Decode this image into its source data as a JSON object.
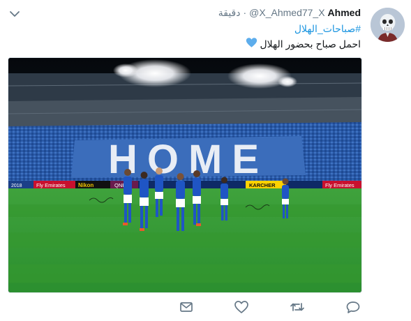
{
  "tweet": {
    "author_name": "Ahmed",
    "author_handle": "@X_Ahmed77_X",
    "separator": "·",
    "timestamp": "دقيقة",
    "hashtag": "#صباحات_الهلال",
    "text": "احمل صباح بحضور الهلال",
    "emoji": "blue-heart-icon"
  },
  "media": {
    "mosaic_text": "HOME",
    "banner_year": "2018",
    "sponsors": [
      "Fly Emirates",
      "Nikon",
      "QNB",
      "KARCHER",
      "Fly Emirates"
    ]
  },
  "actions": [
    "reply-icon",
    "retweet-icon",
    "like-icon",
    "message-icon"
  ],
  "colors": {
    "link": "#1b95e0",
    "text": "#14171a",
    "muted": "#657786",
    "heart": "#5dadec",
    "pitch": "#2f9a33"
  }
}
